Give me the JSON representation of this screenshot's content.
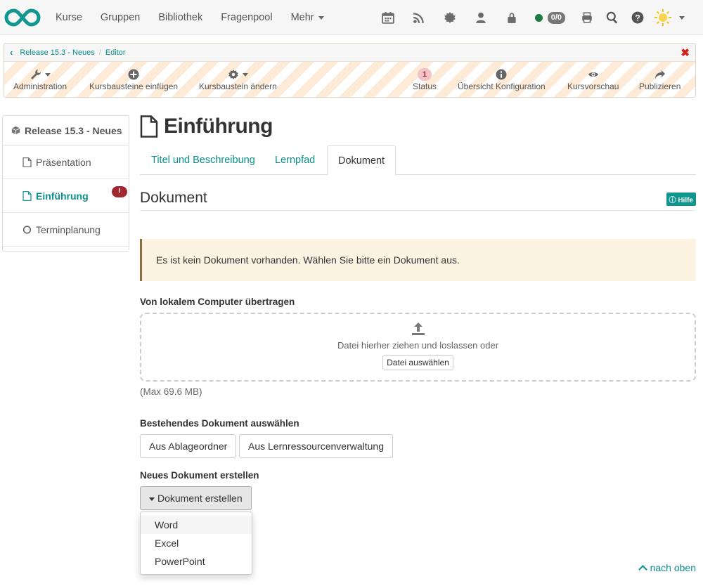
{
  "nav": {
    "items": [
      {
        "label": "Kurse"
      },
      {
        "label": "Gruppen"
      },
      {
        "label": "Bibliothek"
      },
      {
        "label": "Fragenpool"
      },
      {
        "label": "Mehr"
      }
    ],
    "status_count": "0/0",
    "icons": [
      "calendar-icon",
      "rss-icon",
      "gear-icon",
      "user-icon",
      "lock-icon",
      "print-icon",
      "search-icon",
      "help-icon",
      "theme-sun-icon"
    ]
  },
  "breadcrumb": {
    "items": [
      "Release 15.3 - Neues",
      "Editor"
    ]
  },
  "toolbar": {
    "administration": "Administration",
    "insert": "Kursbausteine einfügen",
    "change": "Kursbaustein ändern",
    "status": "Status",
    "status_count": "1",
    "overview": "Übersicht Konfiguration",
    "preview": "Kursvorschau",
    "publish": "Publizieren"
  },
  "sidebar": {
    "title": "Release 15.3 - Neues",
    "items": [
      {
        "label": "Präsentation"
      },
      {
        "label": "Einführung"
      },
      {
        "label": "Terminplanung"
      }
    ]
  },
  "main": {
    "title": "Einführung",
    "tabs": [
      {
        "label": "Titel und Beschreibung"
      },
      {
        "label": "Lernpfad"
      },
      {
        "label": "Dokument"
      }
    ],
    "section_title": "Dokument",
    "help": "Hilfe",
    "warning": "Es ist kein Dokument vorhanden. Wählen Sie bitte ein Dokument aus.",
    "upload_label": "Von lokalem Computer übertragen",
    "drop_text": "Datei hierher ziehen und loslassen oder",
    "choose_file": "Datei auswählen",
    "max_size": "(Max 69.6 MB)",
    "existing_label": "Bestehendes Dokument auswählen",
    "from_folder": "Aus Ablageordner",
    "from_resources": "Aus Lernressourcenverwaltung",
    "new_label": "Neues Dokument erstellen",
    "create_button": "Dokument erstellen",
    "create_options": [
      "Word",
      "Excel",
      "PowerPoint"
    ],
    "to_top": "nach oben"
  },
  "colors": {
    "accent": "#0a8f8a",
    "warning_bg": "#fcf3e3",
    "error_badge": "#a0282e",
    "close_red": "#d0211c"
  }
}
